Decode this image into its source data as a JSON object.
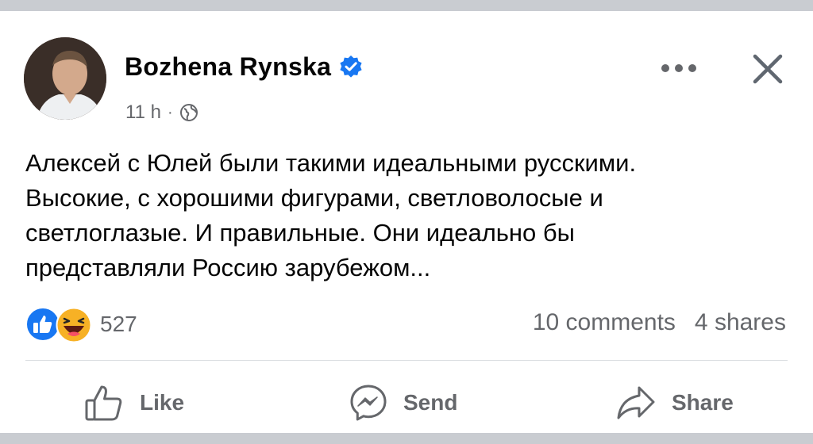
{
  "post": {
    "author": "Bozhena  Rynska",
    "time": "11 h",
    "dot": "·",
    "text_lines": [
      "Алексей с Юлей были такими идеальными русскими.",
      "Высокие, с хорошими фигурами, светловолосые и",
      "светлоглазые. И правильные. Они идеально бы",
      "представляли Россию зарубежом..."
    ]
  },
  "reactions": {
    "count": "527",
    "icons": [
      "like-icon",
      "haha-icon"
    ]
  },
  "stats": {
    "comments": "10 comments",
    "shares": "4 shares"
  },
  "actions": {
    "like": "Like",
    "send": "Send",
    "share": "Share"
  },
  "colors": {
    "verified": "#1877f2",
    "text": "#050505",
    "secondary": "#65676b",
    "haha": "#f7b125"
  }
}
